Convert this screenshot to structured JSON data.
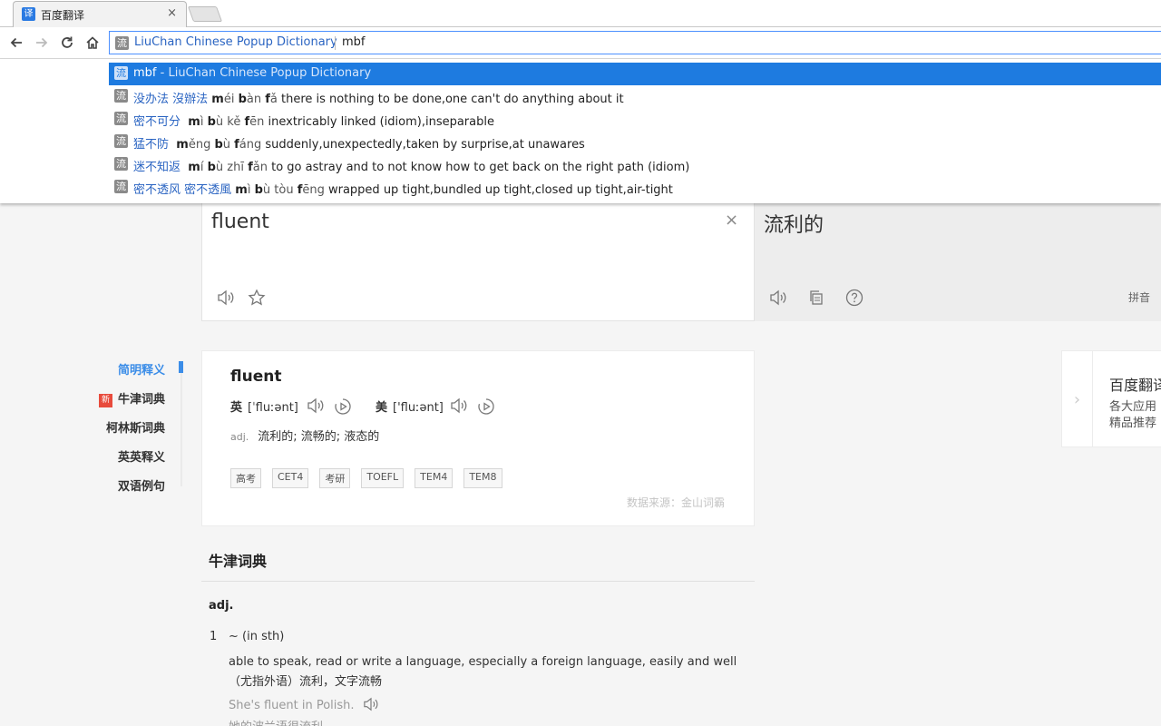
{
  "tab": {
    "title": "百度翻译",
    "favicon": "译",
    "close": "×"
  },
  "omnibox": {
    "keyword_label": "LiuChan Chinese Popup Dictionary",
    "query": "mbf",
    "icon": "流"
  },
  "suggestions": [
    {
      "icon": "流",
      "head": "mbf",
      "tail": "- LiuChan Chinese Popup Dictionary"
    },
    {
      "icon": "流",
      "hanzi": "没办法 沒辦法",
      "pinyin_html": "<b>m</b>éi <b>b</b>àn <b>f</b>ǎ",
      "def": "there is nothing to be done,one can't do anything about it"
    },
    {
      "icon": "流",
      "hanzi": "密不可分",
      "pinyin_html": "<b>m</b>ì <b>b</b>ù kě <b>f</b>ēn",
      "def": "inextricably linked (idiom),inseparable"
    },
    {
      "icon": "流",
      "hanzi": "猛不防",
      "pinyin_html": "<b>m</b>ěng <b>b</b>ù <b>f</b>áng",
      "def": "suddenly,unexpectedly,taken by surprise,at unawares"
    },
    {
      "icon": "流",
      "hanzi": "迷不知返",
      "pinyin_html": "<b>m</b>í <b>b</b>ù zhī <b>f</b>ǎn",
      "def": "to go astray and to not know how to get back on the right path (idiom)"
    },
    {
      "icon": "流",
      "hanzi": "密不透风 密不透風",
      "pinyin_html": "<b>m</b>ì <b>b</b>ù tòu <b>f</b>ēng",
      "def": "wrapped up tight,bundled up tight,closed up tight,air-tight"
    }
  ],
  "source": {
    "text": "fluent",
    "clear": "×"
  },
  "target": {
    "text": "流利的",
    "pinyin_label": "拼音"
  },
  "left_nav": {
    "items": [
      {
        "label": "简明释义",
        "active": true
      },
      {
        "label": "牛津词典",
        "badge": "新"
      },
      {
        "label": "柯林斯词典"
      },
      {
        "label": "英英释义"
      },
      {
        "label": "双语例句"
      }
    ]
  },
  "simple_def": {
    "word": "fluent",
    "uk_label": "英",
    "uk_phonetic": "[ˈfluːənt]",
    "us_label": "美",
    "us_phonetic": "['fluːənt]",
    "pos": "adj.",
    "meanings": "流利的;  流畅的;  液态的",
    "tags": [
      "高考",
      "CET4",
      "考研",
      "TOEFL",
      "TEM4",
      "TEM8"
    ],
    "data_source": "数据来源：金山词霸"
  },
  "side_card": {
    "title": "百度翻译",
    "line1": "各大应用",
    "line2": "精品推荐"
  },
  "oxford": {
    "header": "牛津词典",
    "pos": "adj.",
    "num": "1",
    "pattern": "~ (in sth)",
    "definition": "able to speak, read or write a language, especially a foreign language, easily and well（尤指外语）流利，文字流畅",
    "example": "She's fluent in Polish.",
    "example_cn": "她的波兰语很流利。"
  },
  "colors": {
    "accent": "#3b8de8",
    "selection": "#1e7be0",
    "link": "#2a64c2",
    "badge": "#e84b3c"
  }
}
